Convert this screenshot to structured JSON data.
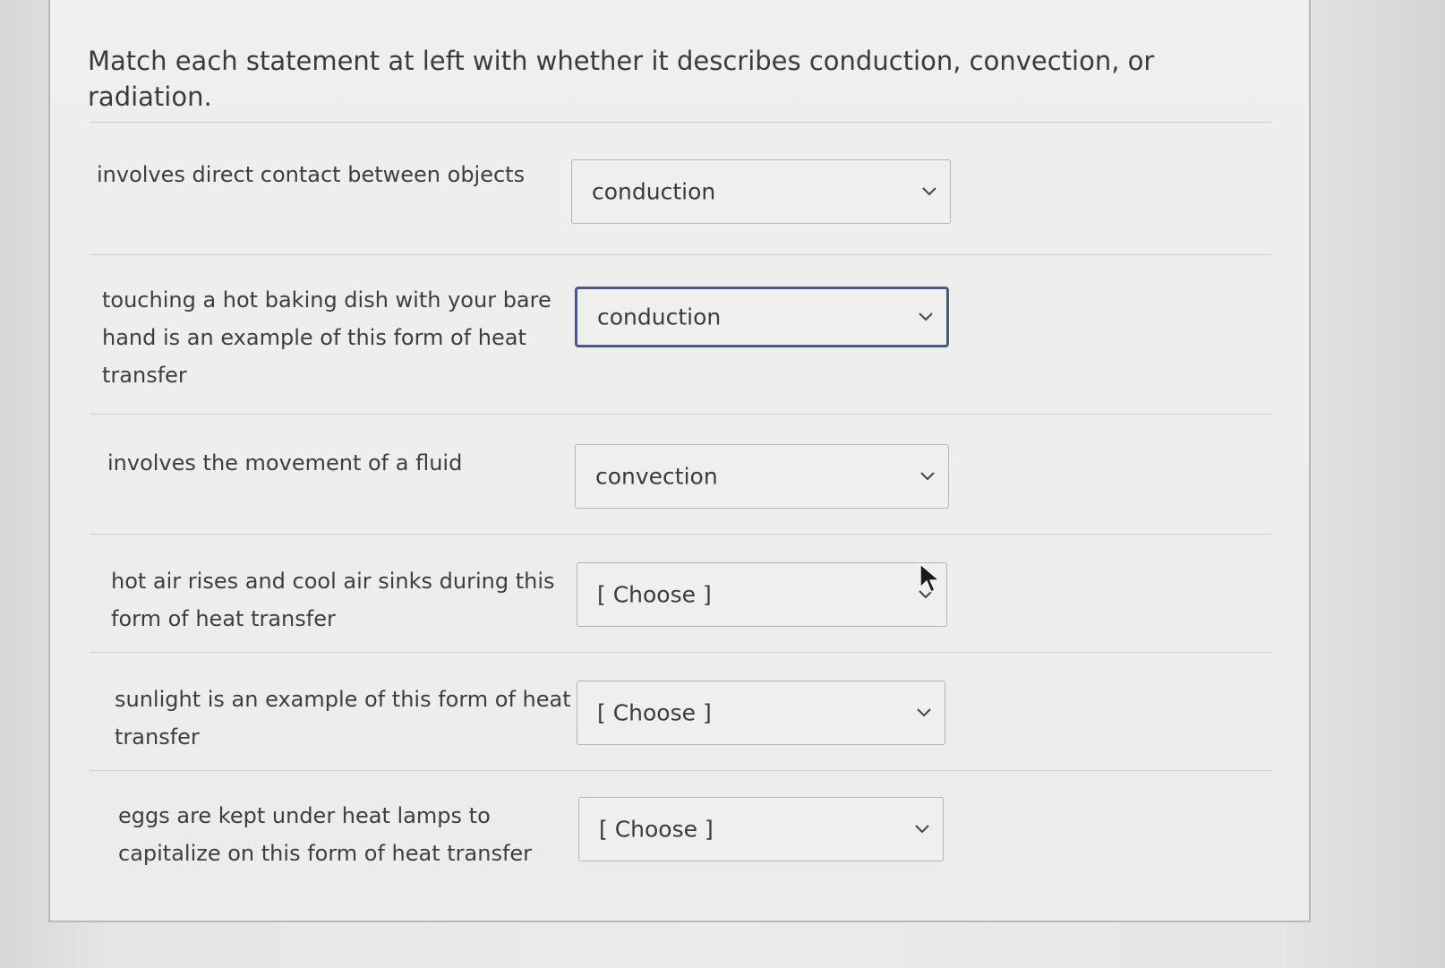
{
  "question": {
    "text": "Match each statement at left with whether it describes conduction, convection, or radiation."
  },
  "rows": [
    {
      "statement_lines": [
        "involves direct contact between objects"
      ],
      "selected": "conduction",
      "focused": false
    },
    {
      "statement_lines": [
        "touching a hot baking dish with your bare",
        "hand is an example of this form of heat",
        "transfer"
      ],
      "selected": "conduction",
      "focused": true
    },
    {
      "statement_lines": [
        "involves the movement of a fluid"
      ],
      "selected": "convection",
      "focused": false
    },
    {
      "statement_lines": [
        "hot air rises and cool air sinks during this",
        "form of heat transfer"
      ],
      "selected": "[ Choose ]",
      "focused": false
    },
    {
      "statement_lines": [
        "sunlight is an example of this form of heat",
        "transfer"
      ],
      "selected": "[ Choose ]",
      "focused": false
    },
    {
      "statement_lines": [
        "eggs are kept under heat lamps to",
        "capitalize on this form of heat transfer"
      ],
      "selected": "[ Choose ]",
      "focused": false
    }
  ],
  "icons": {
    "dropdown": "chevron-down-icon",
    "pointer": "mouse-pointer-icon"
  },
  "colors": {
    "focus_border": "#4a5a88",
    "select_border": "#b4b4b3",
    "text": "#3b3b3b"
  }
}
